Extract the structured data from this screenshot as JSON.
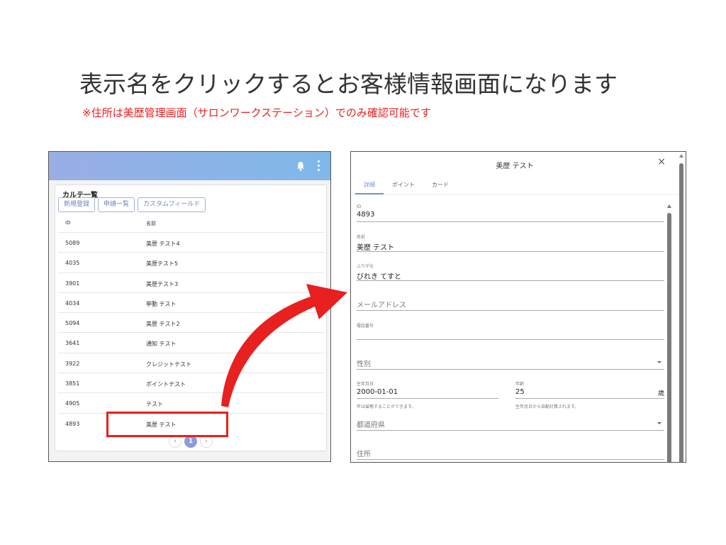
{
  "headline": "表示名をクリックするとお客様情報画面になります",
  "subline": "※住所は美歴管理画面（サロンワークステーション）でのみ確認可能です",
  "left": {
    "card_title": "カルテ一覧",
    "buttons": [
      "新規登録",
      "申請一覧",
      "カスタムフィールド"
    ],
    "columns": {
      "id": "ID",
      "name": "名前"
    },
    "rows": [
      {
        "id": "5089",
        "name": "美歴 テスト4"
      },
      {
        "id": "4035",
        "name": "美歴テスト5"
      },
      {
        "id": "3901",
        "name": "美歴テスト3"
      },
      {
        "id": "4034",
        "name": "挙動 テスト"
      },
      {
        "id": "5094",
        "name": "美歴 テスト2"
      },
      {
        "id": "3641",
        "name": "通知 テスト"
      },
      {
        "id": "3922",
        "name": "クレジットテスト"
      },
      {
        "id": "3851",
        "name": "ポイントテスト"
      },
      {
        "id": "4905",
        "name": "テスト"
      },
      {
        "id": "4893",
        "name": "美歴 テスト"
      }
    ],
    "pager": {
      "prev": "‹",
      "current": "1",
      "next": "›"
    }
  },
  "right": {
    "title": "美歴 テスト",
    "close": "×",
    "tabs": [
      "詳細",
      "ポイント",
      "カード"
    ],
    "fields": {
      "id_label": "ID",
      "id_value": "4893",
      "name_label": "名前",
      "name_value": "美歴 テスト",
      "kana_label": "ふりがな",
      "kana_value": "びれき てすと",
      "email_placeholder": "メールアドレス",
      "phone_label": "電話番号",
      "gender_placeholder": "性別",
      "birth_label": "生年月日",
      "birth_value": "2000-01-01",
      "birth_hint": "年は省略することができます。",
      "age_label": "年齢",
      "age_value": "25",
      "age_unit": "歳",
      "age_hint": "生年月日から自動計算されます。",
      "pref_placeholder": "都道府県",
      "address_placeholder": "住所"
    }
  },
  "colors": {
    "accent": "#7d8fd6",
    "highlight": "#e8201f",
    "header_start": "#9aaee6",
    "header_end": "#7fb9e9"
  }
}
